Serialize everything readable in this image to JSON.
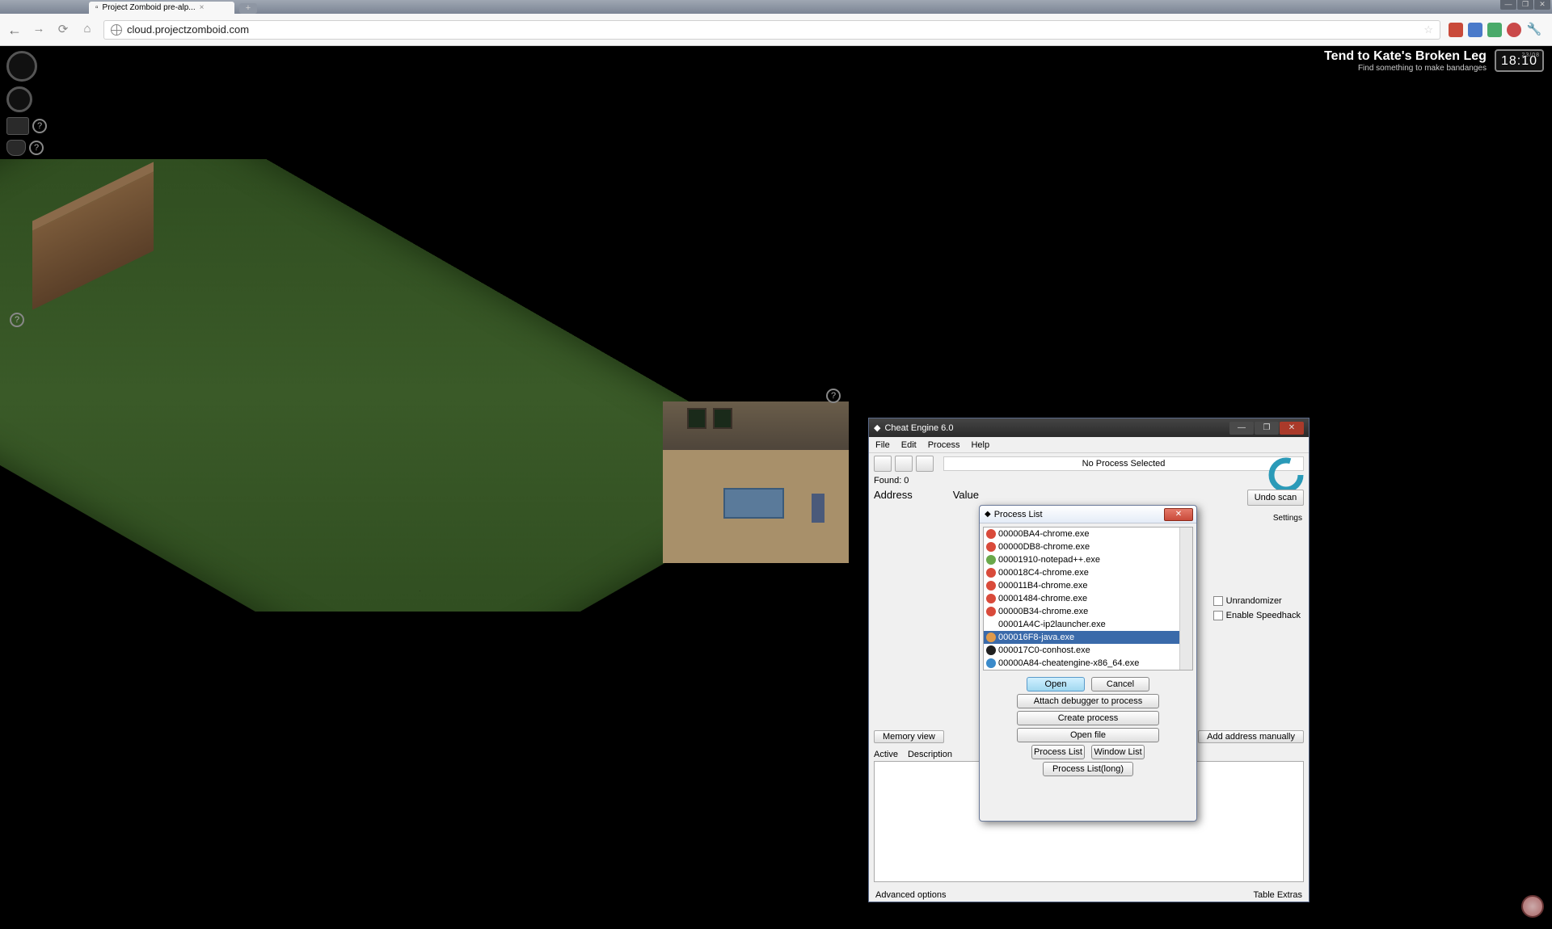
{
  "browser": {
    "tab_title": "Project Zomboid pre-alp...",
    "url": "cloud.projectzomboid.com"
  },
  "game": {
    "objective_title": "Tend to Kate's Broken Leg",
    "objective_sub": "Find something to make bandanges",
    "clock_time": "18:10",
    "clock_date": "23/08"
  },
  "cheat_engine": {
    "title": "Cheat Engine 6.0",
    "menu": [
      "File",
      "Edit",
      "Process",
      "Help"
    ],
    "status": "No Process Selected",
    "found": "Found: 0",
    "col_address": "Address",
    "col_value": "Value",
    "undo_scan": "Undo scan",
    "settings": "Settings",
    "memory_view": "Memory view",
    "add_manual": "Add address manually",
    "tbl_active": "Active",
    "tbl_desc": "Description",
    "advanced": "Advanced options",
    "table_extras": "Table Extras",
    "unrandomizer": "Unrandomizer",
    "speedhack": "Enable Speedhack"
  },
  "process_list": {
    "title": "Process List",
    "items": [
      {
        "pid": "00000BA4",
        "name": "chrome.exe",
        "color": "#d94a3a",
        "sel": false
      },
      {
        "pid": "00000DB8",
        "name": "chrome.exe",
        "color": "#d94a3a",
        "sel": false
      },
      {
        "pid": "00001910",
        "name": "notepad++.exe",
        "color": "#6aa84a",
        "sel": false
      },
      {
        "pid": "000018C4",
        "name": "chrome.exe",
        "color": "#d94a3a",
        "sel": false
      },
      {
        "pid": "000011B4",
        "name": "chrome.exe",
        "color": "#d94a3a",
        "sel": false
      },
      {
        "pid": "00001484",
        "name": "chrome.exe",
        "color": "#d94a3a",
        "sel": false
      },
      {
        "pid": "00000B34",
        "name": "chrome.exe",
        "color": "#d94a3a",
        "sel": false
      },
      {
        "pid": "00001A4C",
        "name": "ip2launcher.exe",
        "color": "#ffffff",
        "sel": false
      },
      {
        "pid": "000016F8",
        "name": "java.exe",
        "color": "#e09a4a",
        "sel": true
      },
      {
        "pid": "000017C0",
        "name": "conhost.exe",
        "color": "#202020",
        "sel": false
      },
      {
        "pid": "00000A84",
        "name": "cheatengine-x86_64.exe",
        "color": "#3a8aca",
        "sel": false
      }
    ],
    "open": "Open",
    "cancel": "Cancel",
    "attach": "Attach debugger to process",
    "create": "Create process",
    "open_file": "Open file",
    "plist": "Process List",
    "wlist": "Window List",
    "plist_long": "Process List(long)"
  }
}
